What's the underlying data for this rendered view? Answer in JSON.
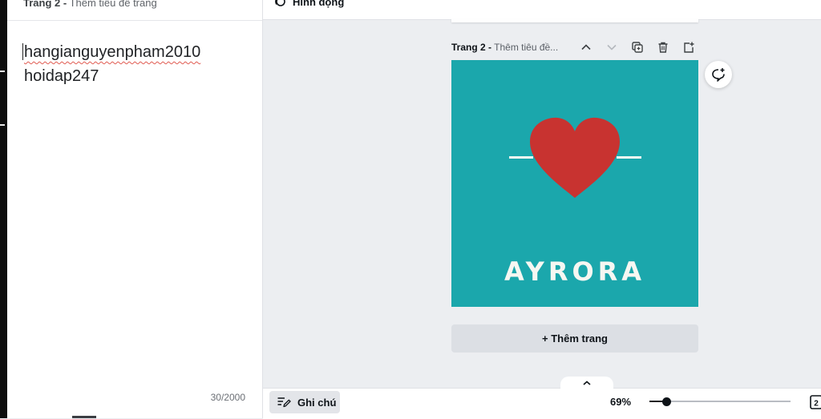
{
  "notes_panel": {
    "header_page": "Trang 2 -",
    "header_title": "Thêm tiêu đề trang",
    "lines": [
      "hangianguyenpham2010",
      "hoidap247"
    ],
    "char_count": "30/2000"
  },
  "toolbar": {
    "animation_label": "Hình động"
  },
  "page": {
    "label": "Trang 2 -",
    "title_placeholder": "Thêm tiêu đề...",
    "design": {
      "brand_text": "AYRORA",
      "background_color": "#1ba7ac",
      "heart_color": "#c83330",
      "line_color": "#f6f7f2"
    }
  },
  "add_page_label": "+ Thêm trang",
  "footer": {
    "notes_label": "Ghi chú",
    "zoom_label": "69%",
    "zoom_fraction": 0.12,
    "page_count": "2"
  }
}
